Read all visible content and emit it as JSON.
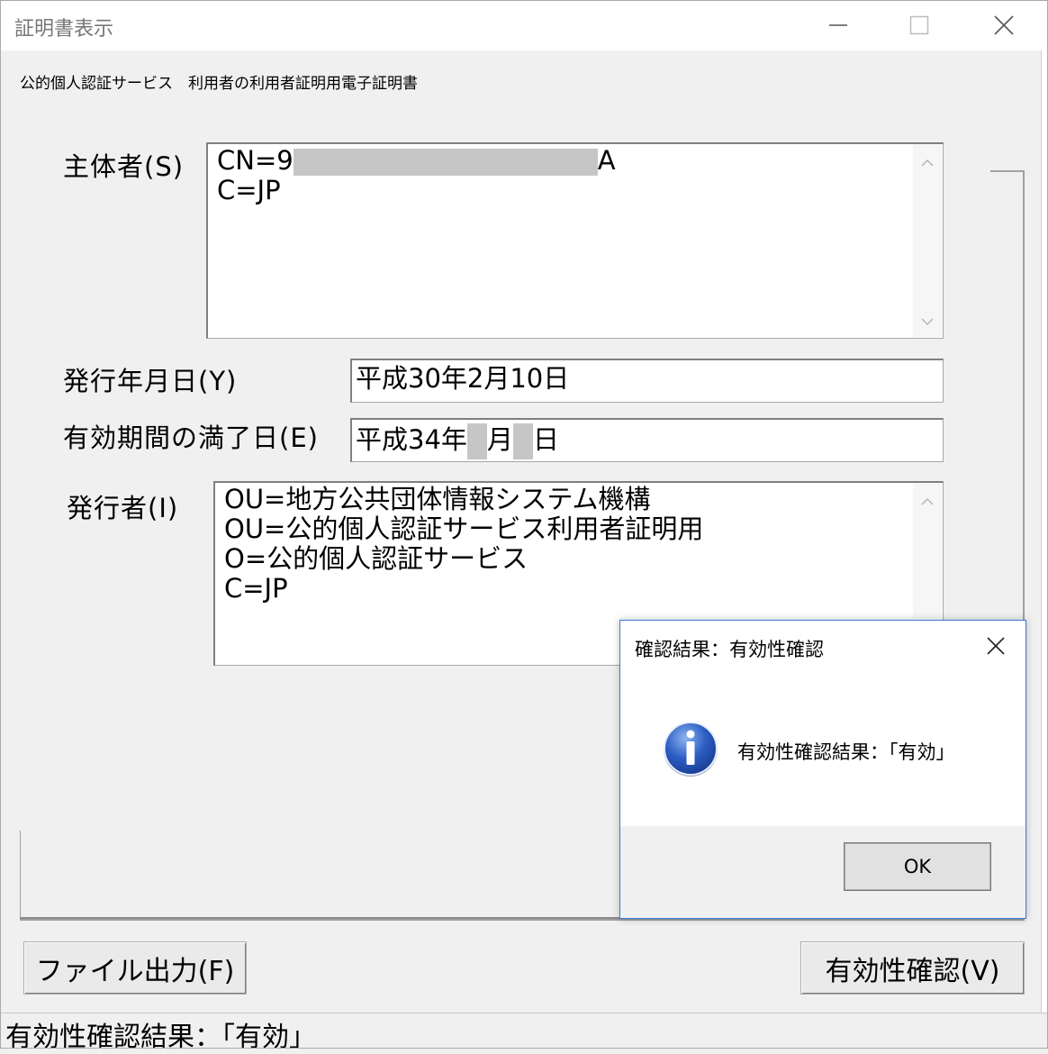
{
  "window": {
    "title": "証明書表示",
    "minimize_icon": "minimize-icon",
    "maximize_icon": "maximize-icon",
    "close_icon": "close-icon"
  },
  "cert_title": "公的個人認証サービス　利用者の利用者証明用電子証明書",
  "subject": {
    "label": "主体者(S)",
    "lines": [
      "CN=9",
      "A",
      "C=JP"
    ]
  },
  "issue_date": {
    "label": "発行年月日(Y)",
    "value": "平成30年2月10日"
  },
  "expiry_date": {
    "label": "有効期間の満了日(E)",
    "prefix": "平成34年",
    "month_unit": "月",
    "day_unit": "日"
  },
  "issuer": {
    "label": "発行者(I)",
    "lines": [
      "OU=地方公共団体情報システム機構",
      "OU=公的個人認証サービス利用者証明用",
      "O=公的個人認証サービス",
      "C=JP"
    ]
  },
  "buttons": {
    "file_output": "ファイル出力(F)",
    "validity_check": "有効性確認(V)"
  },
  "status": "有効性確認結果：「有効」",
  "dialog": {
    "title": "確認結果：有効性確認",
    "message": "有効性確認結果：「有効」",
    "ok": "OK",
    "icon": "info-icon"
  },
  "colors": {
    "dialog_border": "#3d7bd6",
    "info_icon": "#2d5fc4"
  }
}
